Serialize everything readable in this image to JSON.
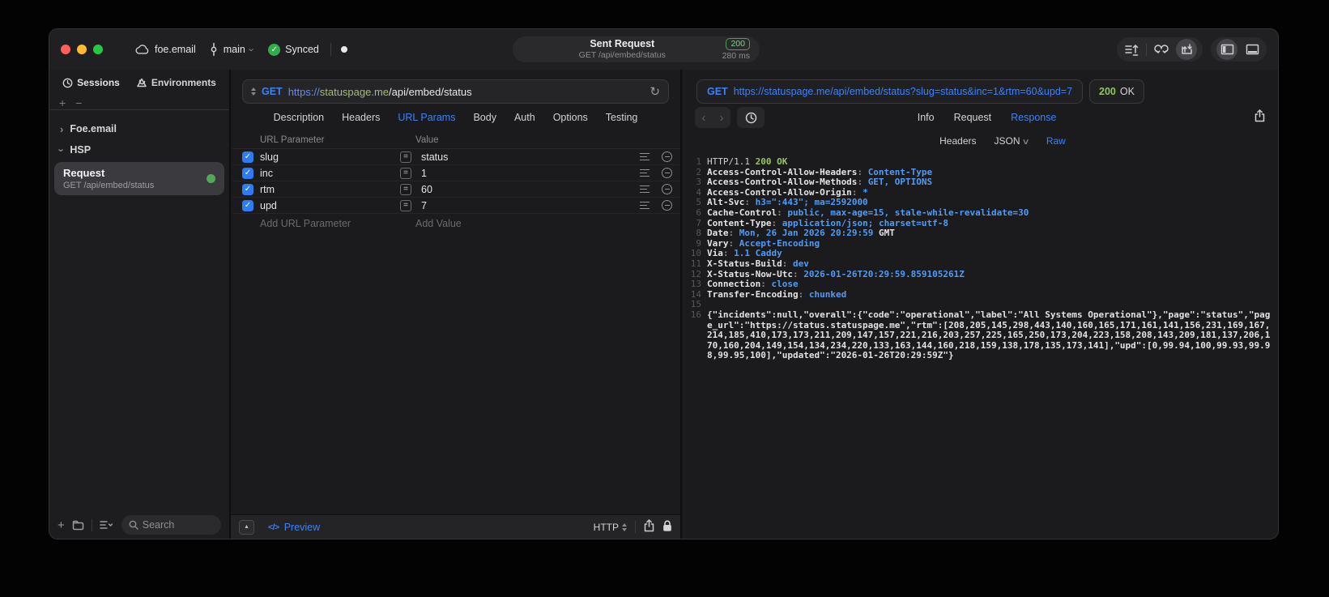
{
  "titlebar": {
    "project": "foe.email",
    "branch": "main",
    "sync_status": "Synced",
    "center": {
      "title": "Sent Request",
      "subtitle": "GET /api/embed/status",
      "status_code": "200",
      "duration": "280 ms"
    }
  },
  "icons": {
    "cloud": "cloud",
    "branch": "git-commit",
    "synced-check": "check-circle",
    "send-lines": "lines-up-arrow",
    "loop": "link-loop",
    "import-export": "box-arrows",
    "sidebar-left": "panel-left",
    "panel-bottom": "panel-bottom",
    "sessions": "clock",
    "environments": "layers",
    "search": "magnifier",
    "refresh": "reload",
    "share": "box-up-arrow",
    "lock": "padlock"
  },
  "sidebar": {
    "tabs": [
      {
        "label": "Sessions"
      },
      {
        "label": "Environments"
      }
    ],
    "add_buttons": {
      "plus": "+",
      "minus": "−"
    },
    "tree": [
      {
        "label": "Foe.email",
        "expanded": false
      },
      {
        "label": "HSP",
        "expanded": true
      }
    ],
    "selected_request": {
      "title": "Request",
      "subtitle": "GET /api/embed/status"
    },
    "search_placeholder": "Search"
  },
  "request_pane": {
    "method": "GET",
    "url_scheme": "https://",
    "url_host": "statuspage.me",
    "url_path": "/api/embed/status",
    "tabs": [
      {
        "label": "Description"
      },
      {
        "label": "Headers"
      },
      {
        "label": "URL Params",
        "active": true
      },
      {
        "label": "Body"
      },
      {
        "label": "Auth"
      },
      {
        "label": "Options"
      },
      {
        "label": "Testing"
      }
    ],
    "params_table": {
      "columns": {
        "name": "URL Parameter",
        "value": "Value"
      },
      "rows": [
        {
          "checked": true,
          "name": "slug",
          "op": "=",
          "value": "status"
        },
        {
          "checked": true,
          "name": "inc",
          "op": "=",
          "value": "1"
        },
        {
          "checked": true,
          "name": "rtm",
          "op": "=",
          "value": "60"
        },
        {
          "checked": true,
          "name": "upd",
          "op": "=",
          "value": "7"
        }
      ],
      "add_row": {
        "name_placeholder": "Add URL Parameter",
        "value_placeholder": "Add Value"
      }
    },
    "footer": {
      "preview_glyph": "</>",
      "preview_label": "Preview",
      "protocol": "HTTP"
    }
  },
  "response_pane": {
    "request_line": {
      "method": "GET",
      "url": "https://statuspage.me/api/embed/status?slug=status&inc=1&rtm=60&upd=7"
    },
    "status": {
      "code": "200",
      "text": "OK"
    },
    "tabs": [
      {
        "label": "Info"
      },
      {
        "label": "Request"
      },
      {
        "label": "Response",
        "active": true
      }
    ],
    "subtabs": [
      {
        "label": "Headers"
      },
      {
        "label": "JSON",
        "chevron": true
      },
      {
        "label": "Raw",
        "active": true
      }
    ],
    "code_lines": [
      {
        "n": "1",
        "seg": [
          {
            "c": "p",
            "t": "HTTP/1.1 "
          },
          {
            "c": "g",
            "t": "200 OK"
          }
        ]
      },
      {
        "n": "2",
        "seg": [
          {
            "c": "k",
            "t": "Access-Control-Allow-Headers"
          },
          {
            "c": "d",
            "t": ": "
          },
          {
            "c": "v",
            "t": "Content-Type"
          }
        ]
      },
      {
        "n": "3",
        "seg": [
          {
            "c": "k",
            "t": "Access-Control-Allow-Methods"
          },
          {
            "c": "d",
            "t": ": "
          },
          {
            "c": "v",
            "t": "GET, OPTIONS"
          }
        ]
      },
      {
        "n": "4",
        "seg": [
          {
            "c": "k",
            "t": "Access-Control-Allow-Origin"
          },
          {
            "c": "d",
            "t": ": "
          },
          {
            "c": "v",
            "t": "*"
          }
        ]
      },
      {
        "n": "5",
        "seg": [
          {
            "c": "k",
            "t": "Alt-Svc"
          },
          {
            "c": "d",
            "t": ": "
          },
          {
            "c": "v",
            "t": "h3=\":443\"; ma=2592000"
          }
        ]
      },
      {
        "n": "6",
        "seg": [
          {
            "c": "k",
            "t": "Cache-Control"
          },
          {
            "c": "d",
            "t": ": "
          },
          {
            "c": "v",
            "t": "public, max-age=15, stale-while-revalidate=30"
          }
        ]
      },
      {
        "n": "7",
        "seg": [
          {
            "c": "k",
            "t": "Content-Type"
          },
          {
            "c": "d",
            "t": ": "
          },
          {
            "c": "v",
            "t": "application/json; charset=utf-8"
          }
        ]
      },
      {
        "n": "8",
        "seg": [
          {
            "c": "k",
            "t": "Date"
          },
          {
            "c": "d",
            "t": ": "
          },
          {
            "c": "v",
            "t": "Mon, 26 Jan 2026 20:29:59"
          },
          {
            "c": "k",
            "t": " GMT"
          }
        ]
      },
      {
        "n": "9",
        "seg": [
          {
            "c": "k",
            "t": "Vary"
          },
          {
            "c": "d",
            "t": ": "
          },
          {
            "c": "v",
            "t": "Accept-Encoding"
          }
        ]
      },
      {
        "n": "10",
        "seg": [
          {
            "c": "k",
            "t": "Via"
          },
          {
            "c": "d",
            "t": ": "
          },
          {
            "c": "v",
            "t": "1.1 Caddy"
          }
        ]
      },
      {
        "n": "11",
        "seg": [
          {
            "c": "k",
            "t": "X-Status-Build"
          },
          {
            "c": "d",
            "t": ": "
          },
          {
            "c": "v",
            "t": "dev"
          }
        ]
      },
      {
        "n": "12",
        "seg": [
          {
            "c": "k",
            "t": "X-Status-Now-Utc"
          },
          {
            "c": "d",
            "t": ": "
          },
          {
            "c": "v",
            "t": "2026-01-26T20:29:59.859105261Z"
          }
        ]
      },
      {
        "n": "13",
        "seg": [
          {
            "c": "k",
            "t": "Connection"
          },
          {
            "c": "d",
            "t": ": "
          },
          {
            "c": "v",
            "t": "close"
          }
        ]
      },
      {
        "n": "14",
        "seg": [
          {
            "c": "k",
            "t": "Transfer-Encoding"
          },
          {
            "c": "d",
            "t": ": "
          },
          {
            "c": "v",
            "t": "chunked"
          }
        ]
      },
      {
        "n": "15",
        "seg": []
      },
      {
        "n": "16",
        "seg": [
          {
            "c": "b",
            "t": "{\"incidents\":null,\"overall\":{\"code\":\"operational\",\"label\":\"All Systems Operational\"},\"page\":\"status\",\"page_url\":\"https://status.statuspage.me\",\"rtm\":[208,205,145,298,443,140,160,165,171,161,141,156,231,169,167,214,185,410,173,173,211,209,147,157,221,216,203,257,225,165,250,173,204,223,158,208,143,209,181,137,206,170,160,204,149,154,134,234,220,133,163,144,160,218,159,138,178,135,173,141],\"upd\":[0,99.94,100,99.93,99.98,99.95,100],\"updated\":\"2026-01-26T20:29:59Z\"}"
          }
        ]
      }
    ]
  },
  "colors": {
    "accent_blue": "#3e82f7",
    "value_blue": "#4f9cf8",
    "status_green": "#80d37d",
    "code_green": "#9bc362",
    "checkbox_blue": "#2e7bf6",
    "dot_green": "#4faa57"
  }
}
